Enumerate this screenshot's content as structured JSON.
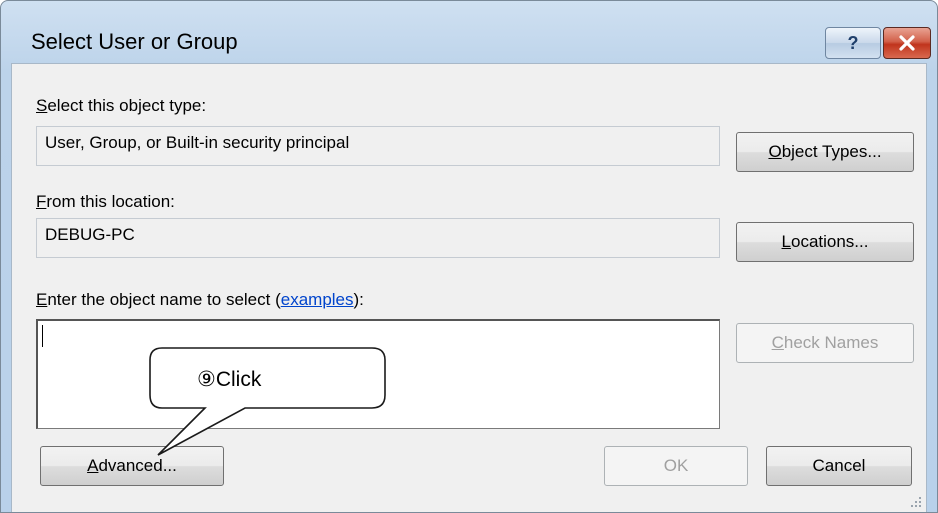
{
  "window": {
    "title": "Select User or Group",
    "help_glyph": "?",
    "close_glyph": "✕"
  },
  "object_type": {
    "label_key": "S",
    "label_rest": "elect this object type:",
    "value": "User, Group, or Built-in security principal",
    "button_key": "O",
    "button_rest": "bject Types..."
  },
  "location": {
    "label_key": "F",
    "label_rest": "rom this location:",
    "value": "DEBUG-PC",
    "button_key": "L",
    "button_rest": "ocations..."
  },
  "object_name": {
    "label_key": "E",
    "label_rest": "nter the object name to select (",
    "link_text": "examples",
    "label_tail": "):",
    "value": "",
    "check_button_key": "C",
    "check_button_rest": "heck Names"
  },
  "footer": {
    "advanced_key": "A",
    "advanced_rest": "dvanced...",
    "ok_label": "OK",
    "cancel_label": "Cancel"
  },
  "annotation": {
    "callout_text": "⑨Click"
  },
  "colors": {
    "title_bar": "#bcd3ea",
    "dialog_bg": "#f0f0f0",
    "link": "#0044cc",
    "close_red": "#c0341d"
  },
  "icons": [
    "help-icon",
    "close-icon",
    "resize-grip-icon"
  ]
}
